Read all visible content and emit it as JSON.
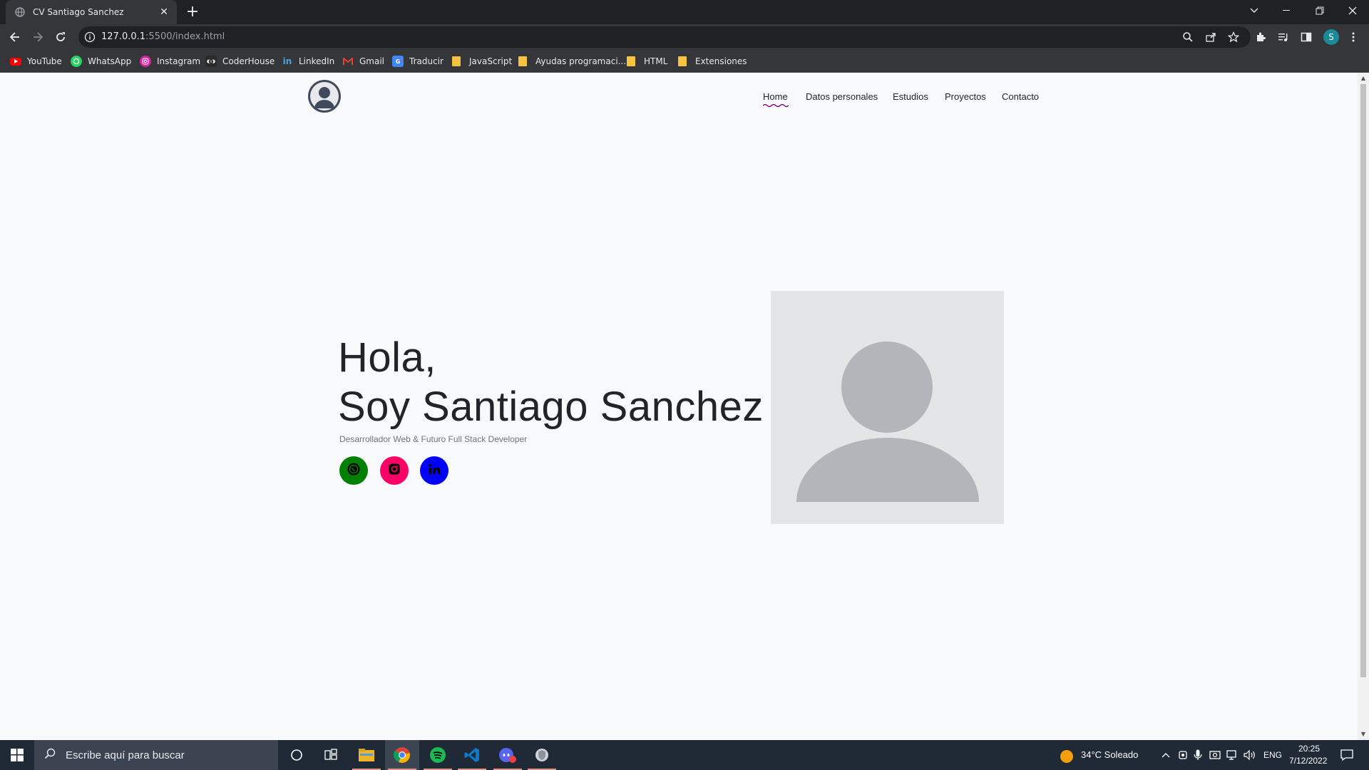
{
  "browser": {
    "tab_title": "CV Santiago Sanchez",
    "new_tab_symbol": "+",
    "url_host": "127.0.0.1",
    "url_rest": ":5500/index.html",
    "profile_initial": "S",
    "bookmarks": [
      {
        "label": "YouTube",
        "icon": "youtube-icon"
      },
      {
        "label": "WhatsApp",
        "icon": "whatsapp-icon"
      },
      {
        "label": "Instagram",
        "icon": "instagram-icon"
      },
      {
        "label": "CoderHouse",
        "icon": "coderhouse-icon"
      },
      {
        "label": "LinkedIn",
        "icon": "linkedin-icon"
      },
      {
        "label": "Gmail",
        "icon": "gmail-icon"
      },
      {
        "label": "Traducir",
        "icon": "translate-icon"
      },
      {
        "label": "JavaScript",
        "icon": "folder-icon"
      },
      {
        "label": "Ayudas programaci...",
        "icon": "folder-icon"
      },
      {
        "label": "HTML",
        "icon": "folder-icon"
      },
      {
        "label": "Extensiones",
        "icon": "folder-icon"
      }
    ]
  },
  "page": {
    "nav": [
      "Home",
      "Datos personales",
      "Estudios",
      "Proyectos",
      "Contacto"
    ],
    "active_nav": "Home",
    "hero": {
      "greeting": "Hola,",
      "name_line": "Soy Santiago Sanchez",
      "subtitle": "Desarrollador Web & Futuro Full Stack Developer"
    },
    "social": [
      {
        "name": "whatsapp",
        "color": "#008000"
      },
      {
        "name": "instagram",
        "color": "#ff0066"
      },
      {
        "name": "linkedin",
        "color": "#0000ff"
      }
    ],
    "accent_color": "#800080"
  },
  "taskbar": {
    "search_placeholder": "Escribe aquí para buscar",
    "weather": "34°C  Soleado",
    "language": "ENG",
    "time": "20:25",
    "date": "7/12/2022"
  }
}
